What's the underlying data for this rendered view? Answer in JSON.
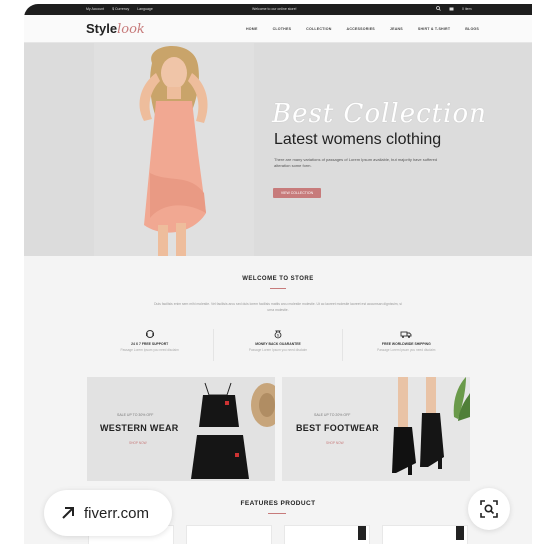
{
  "topbar": {
    "account": "My Account",
    "currency": "$ Currency",
    "language": "Language",
    "welcome": "Welcome to our online store!",
    "cart": "0 item"
  },
  "header": {
    "logo_main": "Style",
    "logo_script": "look",
    "nav": [
      "HOME",
      "CLOTHES",
      "COLLECTION",
      "ACCESSORIES",
      "JEANS",
      "SHIRT & T-SHIRT",
      "BLOGS"
    ]
  },
  "hero": {
    "script_title": "Best Collection",
    "title": "Latest womens clothing",
    "text": "There are many variations of passages of Lorem Ipsum available, but majority have suffered alteration some form.",
    "button": "VIEW COLLECTION"
  },
  "welcome": {
    "title": "WELCOME TO STORE",
    "text": "Duis facilisis enim sem mihi molestie. Vel facilisis arcu sed duis lorem facilisis mattis arcu molestie molestie. Ut ac laoreet molestie laoreet est accumsan dignissim, si urna molestie."
  },
  "features": [
    {
      "icon": "support-icon",
      "title": "24 X 7 FREE SUPPORT",
      "sub": "Passage Lorem Ipsum you need disclaim"
    },
    {
      "icon": "money-bag-icon",
      "title": "MONEY BACK GUARANTEE",
      "sub": "Passage Lorem Ipsum you need disclaim"
    },
    {
      "icon": "truck-icon",
      "title": "FREE WORLDWIDE SHIPPING",
      "sub": "Passage Lorem Ipsum you need disclaim"
    }
  ],
  "banners": [
    {
      "small": "SALE UP TO 30% OFF",
      "big": "WESTERN WEAR",
      "link": "SHOP NOW"
    },
    {
      "small": "SALE UP TO 20% OFF",
      "big": "BEST FOOTWEAR",
      "link": "SHOP NOW"
    }
  ],
  "products": {
    "title": "FEATURES PRODUCT"
  },
  "overlay": {
    "fiverr": "fiverr.com"
  },
  "colors": {
    "accent": "#c77b7b",
    "dark": "#1e1e1e",
    "hero_bg": "#dcdcdc"
  }
}
